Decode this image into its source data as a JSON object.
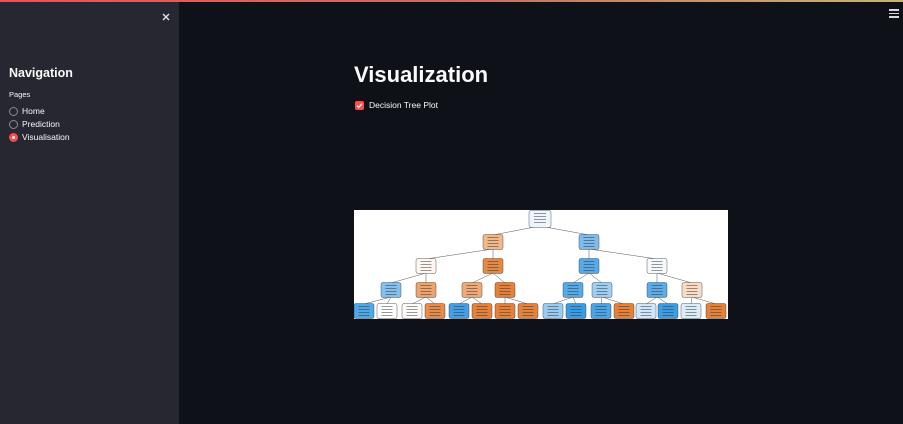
{
  "sidebar": {
    "title": "Navigation",
    "radio_group_label": "Pages",
    "pages": [
      {
        "label": "Home",
        "selected": false
      },
      {
        "label": "Prediction",
        "selected": false
      },
      {
        "label": "Visualisation",
        "selected": true
      }
    ]
  },
  "main": {
    "title": "Visualization",
    "checkbox": {
      "label": "Decision Tree Plot",
      "checked": true
    }
  },
  "icons": {
    "close": "close-icon",
    "menu": "hamburger-menu-icon",
    "check": "check-icon"
  },
  "colors": {
    "background": "#0e1117",
    "sidebar": "#262730",
    "accent": "#ff4b4b",
    "tree_node_orange": "#e58139",
    "tree_node_blue": "#399de5"
  }
}
